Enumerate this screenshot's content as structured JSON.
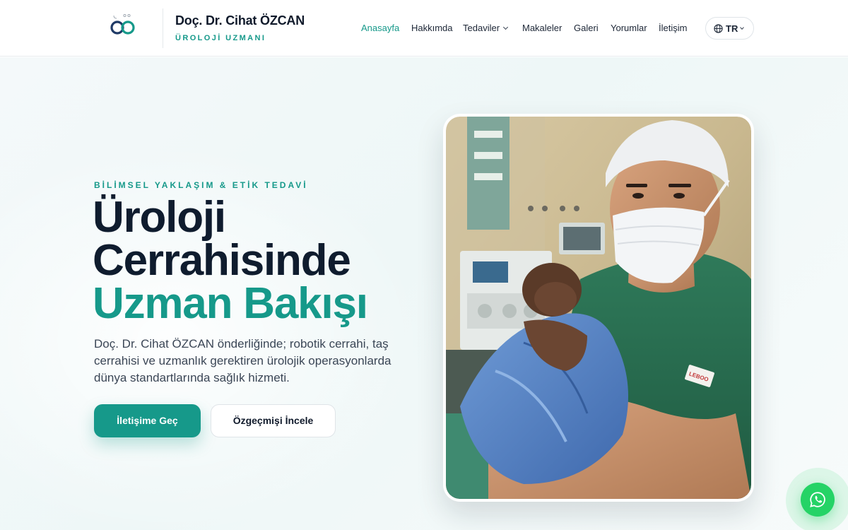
{
  "header": {
    "brand_name": "Doç. Dr. Cihat ÖZCAN",
    "brand_subtitle": "ÜROLOJİ UZMANI",
    "logo_icon": "infinity-logo-icon",
    "nav": [
      {
        "label": "Anasayfa",
        "active": true,
        "dropdown": false
      },
      {
        "label": "Hakkımda",
        "active": false,
        "dropdown": false
      },
      {
        "label": "Tedaviler",
        "active": false,
        "dropdown": true
      },
      {
        "label": "Makaleler",
        "active": false,
        "dropdown": false
      },
      {
        "label": "Galeri",
        "active": false,
        "dropdown": false
      },
      {
        "label": "Yorumlar",
        "active": false,
        "dropdown": false
      },
      {
        "label": "İletişim",
        "active": false,
        "dropdown": false
      }
    ],
    "language": {
      "label": "TR",
      "icon": "globe-icon"
    }
  },
  "hero": {
    "eyebrow": "BİLİMSEL YAKLAŞIM & ETİK TEDAVİ",
    "title_line1": "Üroloji",
    "title_line2": "Cerrahisinde",
    "title_line3": "Uzman Bakışı",
    "description": "Doç. Dr. Cihat ÖZCAN önderliğinde; robotik cerrahi, taş cerrahisi ve uzmanlık gerektiren ürolojik operasyonlarda dünya standartlarında sağlık hizmeti.",
    "primary_button": "İletişime Geç",
    "secondary_button": "Özgeçmişi İncele",
    "photo_badge": "LEBOO"
  },
  "floating": {
    "whatsapp_icon": "whatsapp-icon"
  },
  "colors": {
    "accent": "#16998a",
    "heading": "#0f1c2e",
    "whatsapp": "#25d366"
  }
}
